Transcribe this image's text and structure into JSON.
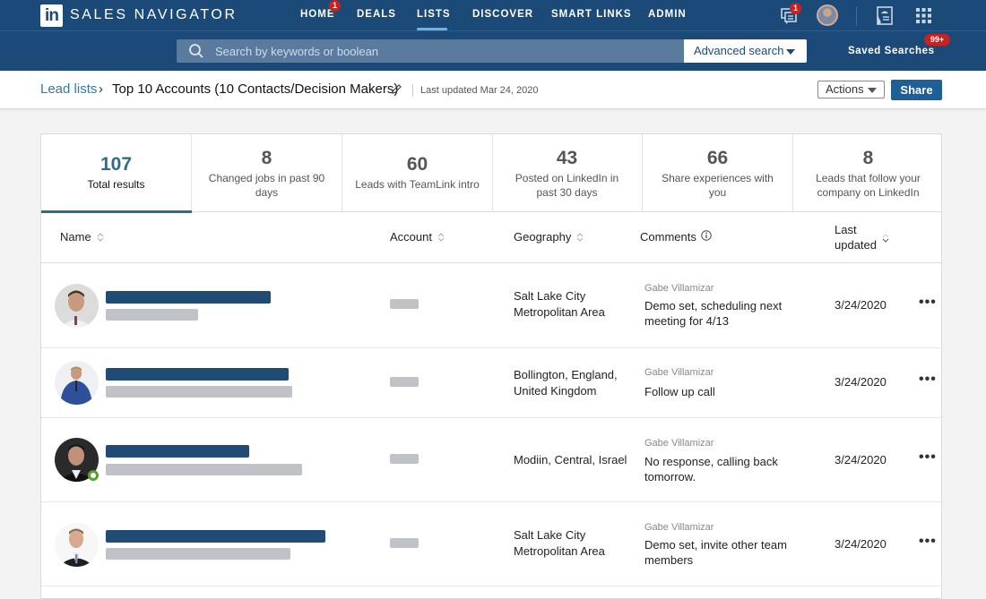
{
  "app": {
    "logo_text": "in",
    "brand": "SALES NAVIGATOR"
  },
  "nav": {
    "items": [
      {
        "label": "HOME",
        "badge": "1"
      },
      {
        "label": "DEALS"
      },
      {
        "label": "LISTS",
        "active": true
      },
      {
        "label": "DISCOVER"
      },
      {
        "label": "SMART LINKS"
      },
      {
        "label": "ADMIN"
      }
    ],
    "messages_badge": "1",
    "icons": [
      "messages-icon",
      "profile-avatar",
      "admin-center-icon",
      "apps-grid-icon"
    ]
  },
  "search": {
    "placeholder": "Search by keywords or boolean",
    "advanced_label": "Advanced search",
    "saved_searches_label": "Saved Searches",
    "saved_searches_badge": "99+"
  },
  "breadcrumb": {
    "parent": "Lead lists",
    "separator": "›",
    "title": "Top 10 Accounts (10 Contacts/Decision Makers)",
    "last_updated": "Last updated Mar 24, 2020"
  },
  "toolbar": {
    "actions_label": "Actions",
    "share_label": "Share"
  },
  "stats": [
    {
      "value": "107",
      "label": "Total results",
      "active": true
    },
    {
      "value": "8",
      "label": "Changed jobs in past 90 days"
    },
    {
      "value": "60",
      "label": "Leads with TeamLink intro"
    },
    {
      "value": "43",
      "label": "Posted on LinkedIn in past 30 days"
    },
    {
      "value": "66",
      "label": "Share experiences with you"
    },
    {
      "value": "8",
      "label": "Leads that follow your company on LinkedIn"
    }
  ],
  "table": {
    "columns": [
      "Name",
      "Account",
      "Geography",
      "Comments",
      "Last updated"
    ],
    "rows": [
      {
        "geography": "Salt Lake City Metropolitan Area",
        "commenter": "Gabe Villamizar",
        "comment": "Demo set, scheduling next meeting for 4/13",
        "last_updated": "3/24/2020",
        "online": false
      },
      {
        "geography": "Bollington, England, United Kingdom",
        "commenter": "Gabe Villamizar",
        "comment": "Follow up call",
        "last_updated": "3/24/2020",
        "online": false
      },
      {
        "geography": "Modiin, Central, Israel",
        "commenter": "Gabe Villamizar",
        "comment": "No response, calling back tomorrow.",
        "last_updated": "3/24/2020",
        "online": true
      },
      {
        "geography": "Salt Lake City Metropolitan Area",
        "commenter": "Gabe Villamizar",
        "comment": "Demo set, invite other team members",
        "last_updated": "3/24/2020",
        "online": false
      }
    ],
    "more_label": "•••"
  },
  "colors": {
    "brand_navy": "#1c4a78",
    "accent_teal": "#2a6f87",
    "link_blue": "#2f77b8",
    "badge_red": "#cc1f1f",
    "online_green": "#5aa02c"
  }
}
